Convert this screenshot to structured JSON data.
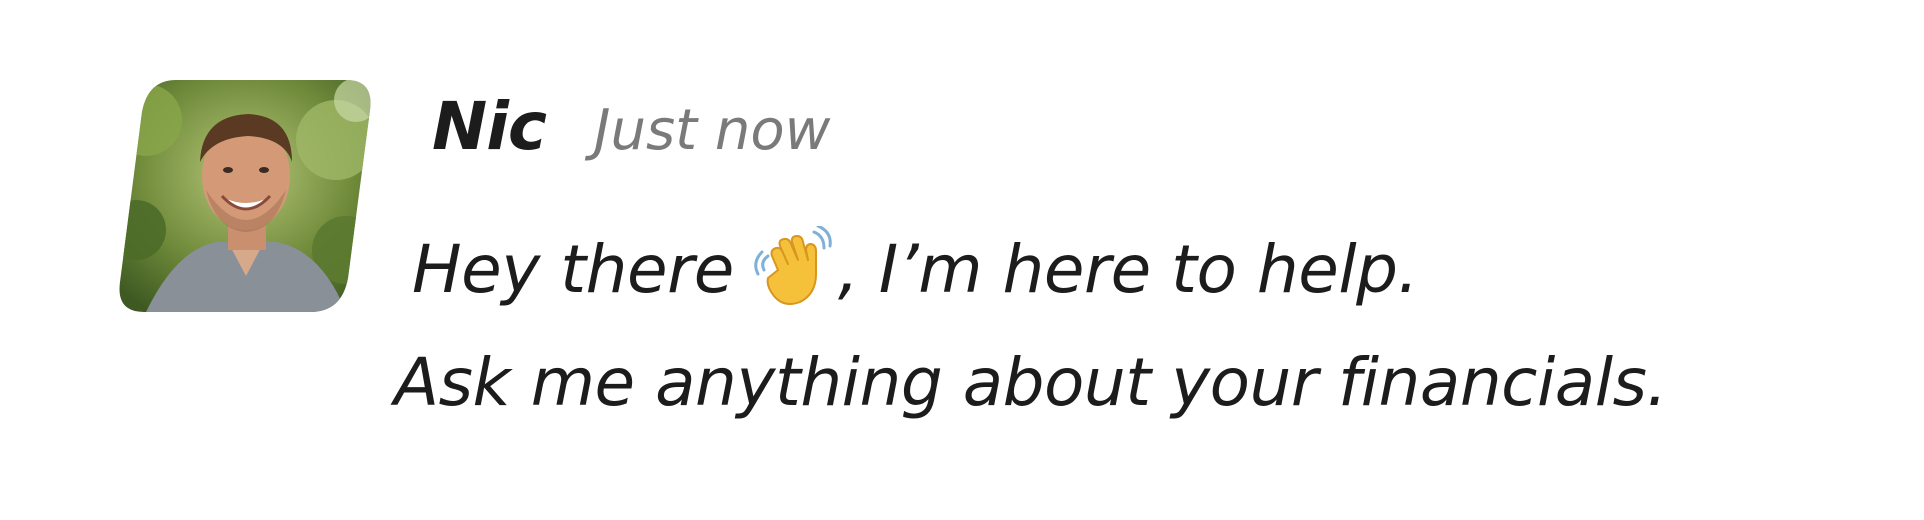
{
  "message": {
    "author": "Nic",
    "timestamp": "Just now",
    "line1_before_icon": "Hey there",
    "line1_after_icon": ", I’m here to help.",
    "line2": "Ask me anything about your financials.",
    "avatar_icon": "person-photo",
    "wave_icon": "waving-hand-emoji"
  },
  "colors": {
    "text": "#1d1c1d",
    "timestamp": "#7a7a7a",
    "background": "#ffffff"
  }
}
